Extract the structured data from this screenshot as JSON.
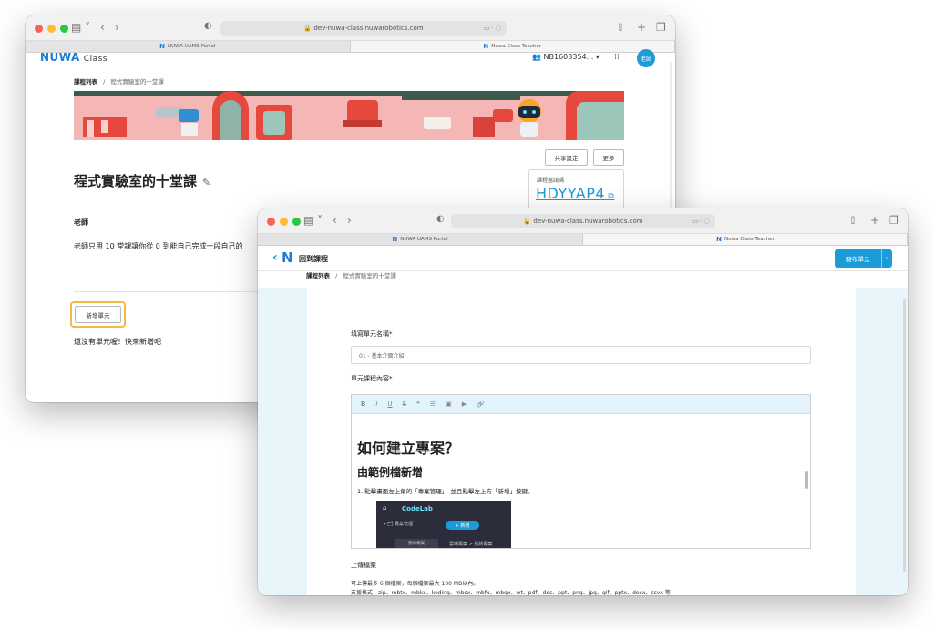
{
  "browser": {
    "url": "dev-nuwa-class.nuwarobotics.com",
    "tabs": [
      "NUWA UAMS Portal",
      "Nuwa Class Teacher"
    ]
  },
  "back": {
    "brand": "NUWA",
    "brand_sub": "Class",
    "account": "NB1603354...",
    "avatar": "老師",
    "crumb_root": "課程列表",
    "crumb_sep": "/",
    "crumb_current": "程式實驗室的十堂課",
    "share_btn": "共享設定",
    "more_btn": "更多",
    "code_label": "課程邀請碼",
    "code_value": "HDYYAP4",
    "course_title": "程式實驗室的十堂課",
    "teacher_label": "老師",
    "description": "老師只用 10 堂課讓你從 0 到能自己完成一段自己的",
    "add_unit": "新增單元",
    "empty": "還沒有單元喔！快來新增吧"
  },
  "front": {
    "back_label": "回到課程",
    "publish": "發布單元",
    "crumb_root": "課程列表",
    "crumb_sep": "/",
    "crumb_current": "程式實驗室的十堂課",
    "unit_name_label": "填寫單元名稱*",
    "unit_name_value": "01 - 基本介面介紹",
    "content_label": "單元課程內容*",
    "toolbar": [
      "B",
      "I",
      "U",
      "S",
      "❝",
      "☰",
      "▣",
      "▶",
      "🔗"
    ],
    "h1": "如何建立專案？",
    "h2": "由範例檔新增",
    "para": "1. 點擊畫面左上角的「專案管理」，並且點擊左上方「新增」按鍵。",
    "codelab": {
      "title": "CodeLab",
      "new_btn": "+ 新增",
      "menu": "▸ 🗂 專案管理",
      "nav": "我的專案",
      "path": "雲端專案 > 我的專案"
    },
    "upload_label": "上傳檔案",
    "upload_line1": "可上傳最多 6 個檔案，每個檔案最大 100 MB以內。",
    "upload_line2": "支援格式：zip、mbtx、mbkx、koding、mbsx、mbfx、mbqx、wt、pdf、doc、ppt、png、jpg、gif、pptx、docx、csvx 等"
  },
  "colors": {
    "accent": "#1d9bd9",
    "highlight": "#f4b942",
    "banner": "#f5b7b5"
  }
}
